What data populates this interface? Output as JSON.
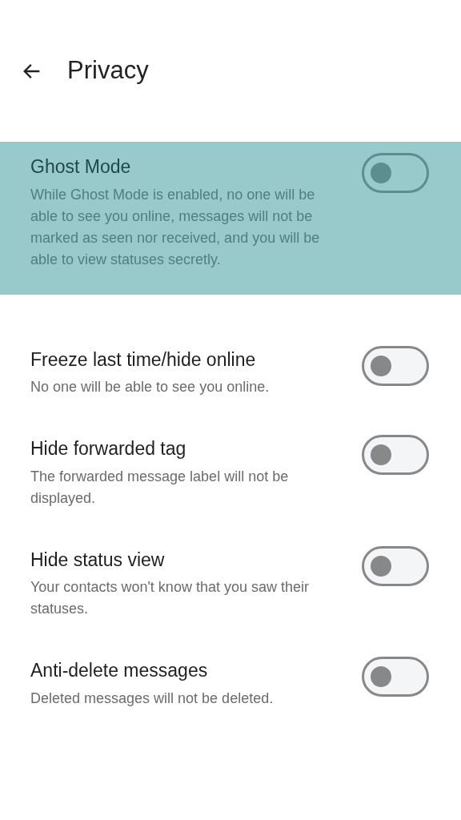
{
  "header": {
    "title": "Privacy"
  },
  "settings": [
    {
      "title": "Ghost Mode",
      "description": "While Ghost Mode is enabled, no one will be able to see you online, messages will not be marked as seen nor received, and you will be able to view statuses secretly.",
      "on": false,
      "highlighted": true
    },
    {
      "title": "Freeze last time/hide online",
      "description": "No one will be able to see you online.",
      "on": false,
      "highlighted": false
    },
    {
      "title": "Hide forwarded tag",
      "description": "The forwarded message label will not be displayed.",
      "on": false,
      "highlighted": false
    },
    {
      "title": "Hide status view",
      "description": "Your contacts won't know that you saw their statuses.",
      "on": false,
      "highlighted": false
    },
    {
      "title": "Anti-delete messages",
      "description": "Deleted messages will not be deleted.",
      "on": false,
      "highlighted": false
    }
  ]
}
